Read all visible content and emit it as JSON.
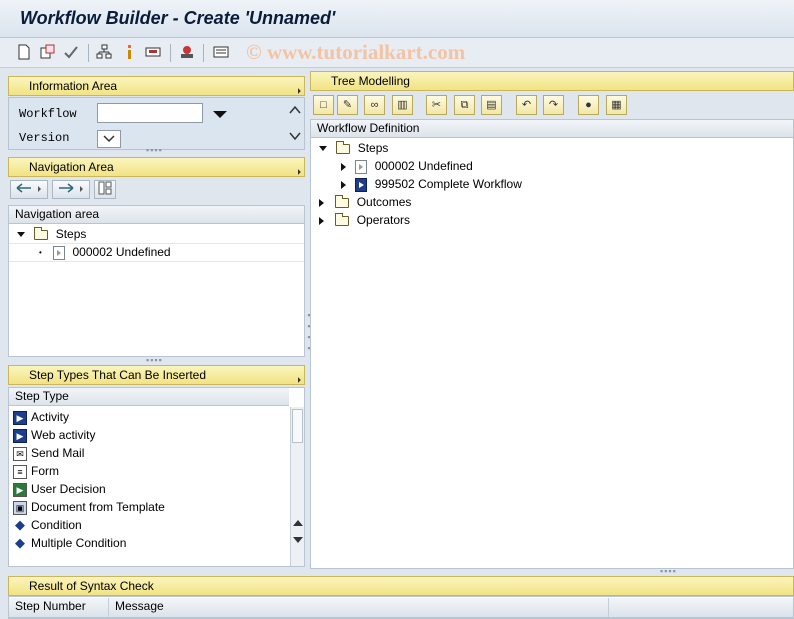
{
  "window": {
    "title": "Workflow Builder - Create 'Unnamed'"
  },
  "watermark": "© www.tutorialkart.com",
  "toolbar": {
    "icons": [
      "new-icon",
      "copy-icon",
      "check-icon",
      "network-icon",
      "info-icon",
      "print-icon",
      "stamp-icon",
      "list-icon"
    ]
  },
  "info_area": {
    "title": "Information Area",
    "workflow_label": "Workflow",
    "workflow_value": "",
    "version_label": "Version",
    "version_value": ""
  },
  "navigation_area": {
    "title": "Navigation Area",
    "column_header": "Navigation area",
    "tree": [
      {
        "label": "Steps",
        "level": 0
      },
      {
        "label": "000002 Undefined",
        "level": 1
      }
    ]
  },
  "step_types": {
    "title": "Step Types That Can Be Inserted",
    "column_header": "Step Type",
    "items": [
      {
        "label": "Activity",
        "icon": "activity-icon"
      },
      {
        "label": "Web activity",
        "icon": "web-activity-icon"
      },
      {
        "label": "Send Mail",
        "icon": "send-mail-icon"
      },
      {
        "label": "Form",
        "icon": "form-icon"
      },
      {
        "label": "User Decision",
        "icon": "user-decision-icon"
      },
      {
        "label": "Document from Template",
        "icon": "document-template-icon"
      },
      {
        "label": "Condition",
        "icon": "condition-icon"
      },
      {
        "label": "Multiple Condition",
        "icon": "multiple-condition-icon"
      }
    ]
  },
  "tree_modelling": {
    "title": "Tree Modelling",
    "column_header": "Workflow Definition",
    "tree": [
      {
        "label": "Steps",
        "level": 0,
        "expanded": true
      },
      {
        "label": "000002 Undefined",
        "level": 1
      },
      {
        "label": "999502 Complete Workflow",
        "level": 1
      },
      {
        "label": "Outcomes",
        "level": 0,
        "expanded": false
      },
      {
        "label": "Operators",
        "level": 0,
        "expanded": false
      }
    ]
  },
  "syntax_check": {
    "title": "Result of Syntax Check",
    "columns": [
      "Step Number",
      "Message"
    ]
  }
}
